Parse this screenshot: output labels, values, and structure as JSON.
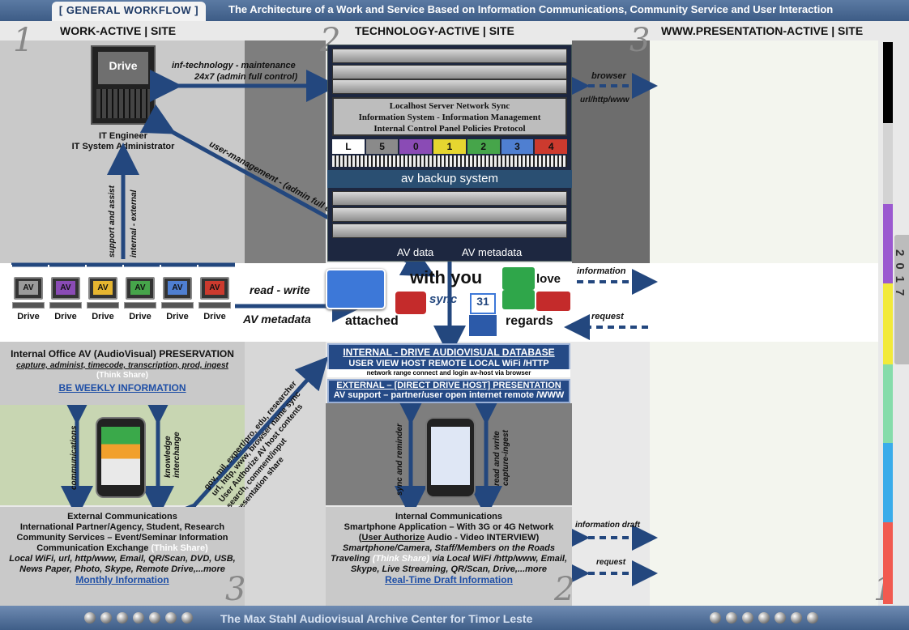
{
  "header": {
    "tab": "[ GENERAL WORKFLOW ]",
    "title": "The Architecture of a Work and Service Based on Information Communications, Community Service and User Interaction"
  },
  "columns": [
    {
      "num": "1",
      "title": "WORK-ACTIVE | SITE"
    },
    {
      "num": "2",
      "title": "TECHNOLOGY-ACTIVE | SITE"
    },
    {
      "num": "3",
      "title": "WWW.PRESENTATION-ACTIVE | SITE"
    }
  ],
  "engineer": {
    "screen": "Drive",
    "line1": "IT Engineer",
    "line2": "IT System Administrator"
  },
  "arrows": {
    "infra_1": "inf-technology - maintenance",
    "infra_2": "24x7 (admin full control)",
    "user_mgmt": "user-management - (admin full control)",
    "support": "support and assist",
    "internal_external": "internal - external",
    "read_write": "read - write",
    "av_metadata": "AV metadata",
    "browser": "browser",
    "url": "url/http/www",
    "information": "information",
    "request": "request",
    "communications": "communications",
    "knowledge": "knowledge interchange",
    "sync_reminder": "sync and reminder",
    "read_write_ingest": "read and write capture-ingest",
    "diag_1": "gov, mil, expert/pro, edu, researcher",
    "diag_2": "url, http, www, browser name sync",
    "diag_3": "User Authorize AV host contents",
    "diag_4": "search, comment/input",
    "diag_5": "presentation share",
    "info_draft": "information draft",
    "request_2": "request"
  },
  "server": {
    "line1": "Localhost Server Network Sync",
    "line2": "Information System - Information Management",
    "line3": "Internal Control Panel Policies Protocol",
    "tabs": [
      "L",
      "5",
      "0",
      "1",
      "2",
      "3",
      "4"
    ],
    "backup": "av backup system",
    "av_data": "AV data",
    "av_meta": "AV metadata"
  },
  "workstations": {
    "labels": [
      "AV",
      "AV",
      "AV",
      "AV",
      "AV",
      "AV"
    ],
    "colors": [
      "#9a9a9a",
      "#8a4bb5",
      "#e6b530",
      "#46a54a",
      "#4f7fd1",
      "#cc3a2e"
    ],
    "drives": [
      "Drive",
      "Drive",
      "Drive",
      "Drive",
      "Drive",
      "Drive"
    ]
  },
  "hub": {
    "with_you": "with you",
    "sync": "sync",
    "love": "love",
    "attached": "attached",
    "regards": "regards",
    "calendar": "31"
  },
  "internal_office": {
    "title": "Internal Office AV (AudioVisual) PRESERVATION",
    "sub": "capture, administ, timecode, transcription, prod, ingest",
    "think": "(Think Share)",
    "link": "BE WEEKLY INFORMATION"
  },
  "database": {
    "title": "INTERNAL - DRIVE AUDIOVISUAL DATABASE",
    "sub": "USER VIEW HOST REMOTE LOCAL WiFi /HTTP",
    "small": "network range connect and login av-host via browser",
    "ext_title": "EXTERNAL – [DIRECT DRIVE HOST] PRESENTATION",
    "ext_sub": "AV support – partner/user open internet remote /WWW"
  },
  "external_comms": {
    "l1": "External Communications",
    "l2": "International Partner/Agency, Student, Research",
    "l3": "Community Services – Event/Seminar Information",
    "l4": "Communication Exchange",
    "think": "(Think Share)",
    "l5": "Local WiFi, url, http/www, Email, QR/Scan, DVD, USB,",
    "l6": "News Paper, Photo, Skype, Remote Drive,...more",
    "link": "Monthly Information"
  },
  "internal_comms": {
    "l1": "Internal Communications",
    "l2": "Smartphone Application – With 3G or 4G Network",
    "l3a": "(",
    "l3b": "User Authorize",
    "l3c": " Audio - Video INTERVIEW)",
    "l4": "Smartphone/Camera, Staff/Members on the Roads",
    "l5a": "Traveling ",
    "think": "(Think Share)",
    "l5b": " via Local WiFi /http/www, Email,",
    "l6": "Skype, Live Streaming, QR/Scan, Drive,...more",
    "link": "Real-Time Draft Information"
  },
  "corner_nums": {
    "bl": "3",
    "bm": "2",
    "br": "1"
  },
  "year": "2017",
  "footer": "The Max Stahl Audiovisual Archive Center for Timor Leste",
  "colors": {
    "arrow": "#23477e",
    "accent": "#3d5c86"
  }
}
